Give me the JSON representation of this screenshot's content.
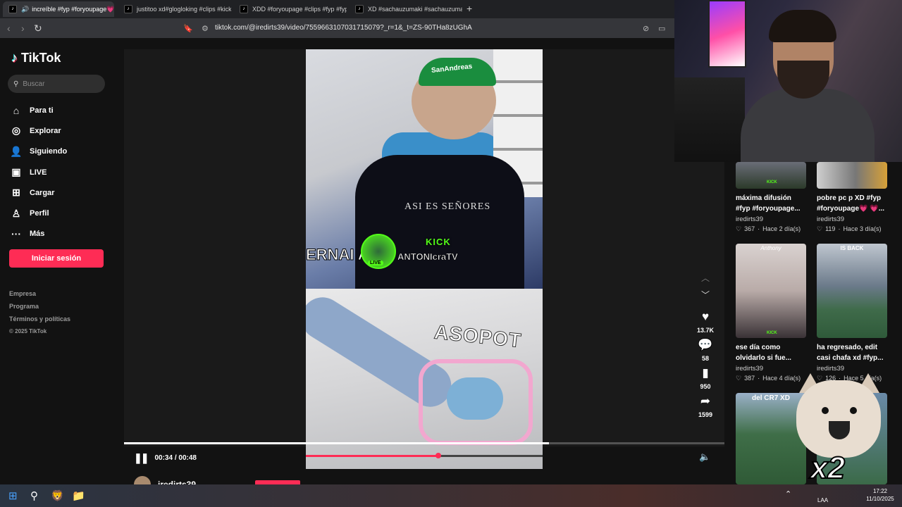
{
  "browser": {
    "tabs": [
      {
        "title": "increíble #fyp #foryoupage💗",
        "active": true
      },
      {
        "title": "justitoo xd#glogloking #clips #kickpa",
        "active": false
      },
      {
        "title": "XDD #foryoupage #clips #fyp #fypp",
        "active": false
      },
      {
        "title": "XD #sachauzumaki #sachauzumakicl",
        "active": false
      }
    ],
    "new_tab": "+",
    "url": "tiktok.com/@iredirts39/video/7559663107031715079?_r=1&_t=ZS-90THa8zUGhA"
  },
  "sidebar": {
    "logo": "TikTok",
    "search_placeholder": "Buscar",
    "nav": [
      {
        "label": "Para ti",
        "icon": "home-icon"
      },
      {
        "label": "Explorar",
        "icon": "compass-icon"
      },
      {
        "label": "Siguiendo",
        "icon": "following-icon"
      },
      {
        "label": "LIVE",
        "icon": "live-icon"
      },
      {
        "label": "Cargar",
        "icon": "upload-icon"
      },
      {
        "label": "Perfil",
        "icon": "profile-icon"
      },
      {
        "label": "Más",
        "icon": "more-icon"
      }
    ],
    "login": "Iniciar sesión",
    "footer": [
      "Empresa",
      "Programa",
      "Términos y políticas"
    ],
    "copyright": "© 2025 TikTok"
  },
  "video": {
    "kick_tag": "KICK",
    "band_text": "ERNAI                     A SO",
    "band_name": "ANTONIcraTV",
    "live_label": "LIVE",
    "shirt_text": "ASI ES SEÑORES",
    "cap_text": "SanAndreas",
    "overlay_text": "ASOPOT",
    "time": "00:34 / 00:48",
    "progress": 0.708,
    "inner_progress": 0.56,
    "author": "iredirts39"
  },
  "actions": {
    "likes": "13.7K",
    "comments": "58",
    "saves": "950",
    "shares": "1599"
  },
  "grid": [
    {
      "title": "máxima difusión #fyp #foryoupage...",
      "user": "iredirts39",
      "likes": "367",
      "age": "Hace 2 día(s)",
      "thumb_label": ""
    },
    {
      "title": "pobre pc p XD #fyp #foryoupage💗 💗...",
      "user": "iredirts39",
      "likes": "119",
      "age": "Hace 3 día(s)",
      "thumb_label": ""
    },
    {
      "title": "ese día como olvidarlo si fue...",
      "user": "iredirts39",
      "likes": "387",
      "age": "Hace 4 día(s)",
      "thumb_label": "Anthony"
    },
    {
      "title": "ha regresado, edit casi chafa xd #fyp...",
      "user": "iredirts39",
      "likes": "126",
      "age": "Hace 5 día(s)",
      "thumb_label": "IS BACK"
    },
    {
      "title": "",
      "user": "",
      "likes": "",
      "age": "",
      "thumb_label": "del CR7 XD"
    }
  ],
  "overlay": {
    "x2": "x2"
  },
  "taskbar": {
    "lang": "LAA",
    "time": "17:22",
    "date": "11/10/2025"
  }
}
